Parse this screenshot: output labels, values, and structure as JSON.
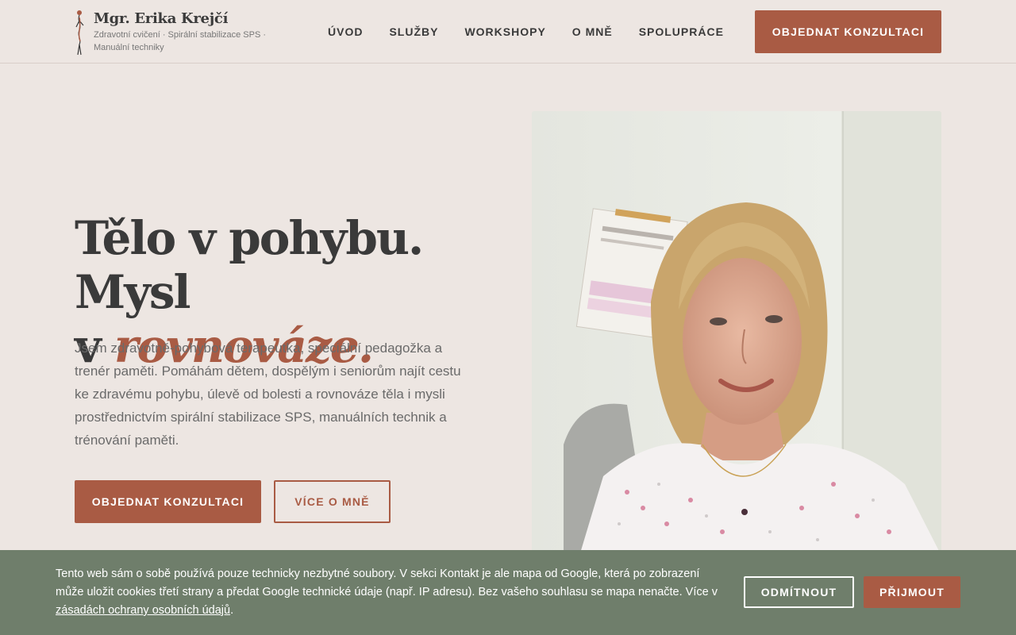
{
  "header": {
    "brand_name": "Mgr. Erika Krejčí",
    "brand_tagline": "Zdravotní cvičení · Spirální stabilizace SPS · Manuální techniky",
    "nav": [
      "ÚVOD",
      "SLUŽBY",
      "WORKSHOPY",
      "O MNĚ",
      "SPOLUPRÁCE"
    ],
    "cta_label": "OBJEDNAT KONZULTACI"
  },
  "hero": {
    "title_line1": "Tělo v pohybu. Mysl",
    "title_line2_prefix": "v ",
    "title_line2_emphasis": "rovnováze.",
    "text": "Jsem zdravotně-pohybová terapeutka, speciální pedagožka a trenér paměti. Pomáhám dětem, dospělým i seniorům najít cestu ke zdravému pohybu, úlevě od bolesti a rovnováze těla i mysli prostřednictvím spirální stabilizace SPS, manuálních technik a trénování paměti.",
    "primary_button": "OBJEDNAT KONZULTACI",
    "secondary_button": "VÍCE O MNĚ"
  },
  "photo": {
    "icon": "portrait-photo"
  },
  "cookie_bar": {
    "text": "Tento web sám o sobě používá pouze technicky nezbytné soubory. V sekci Kontakt je ale mapa od Google, která po zobrazení může uložit cookies třetí strany a předat Google technické údaje (např. IP adresu). Bez vašeho souhlasu se mapa nenačte. Více v ",
    "link_text": "zásadách ochrany osobních údajů",
    "text_end": ".",
    "decline_label": "ODMÍTNOUT",
    "accept_label": "PŘIJMOUT"
  },
  "colors": {
    "background": "#ede6e2",
    "accent": "#a95b44",
    "cookie_bar": "#6f7e6b",
    "text_dark": "#3a3a3a",
    "text_muted": "#6a6a6a"
  }
}
